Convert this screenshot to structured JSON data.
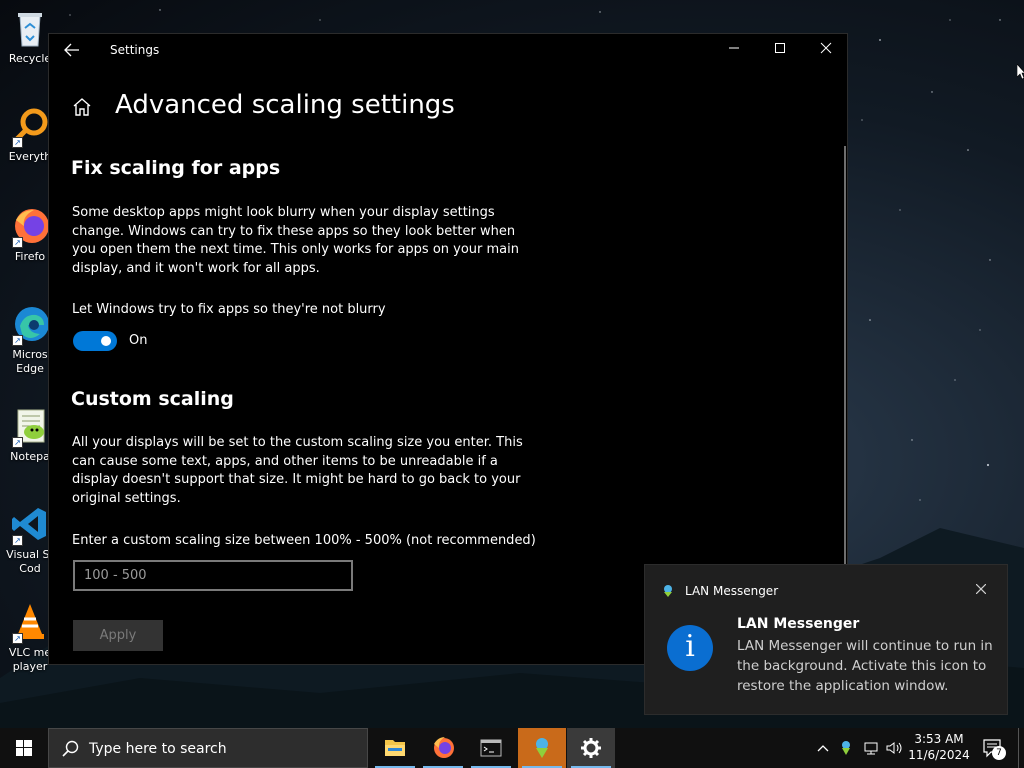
{
  "desktop": {
    "icons": [
      {
        "label": "Recycle"
      },
      {
        "label": "Everyth"
      },
      {
        "label": "Firefo"
      },
      {
        "label": "Micros\nEdge"
      },
      {
        "label": "Notepa"
      },
      {
        "label": "Visual St\nCod"
      },
      {
        "label": "VLC me\nplayer"
      }
    ]
  },
  "window": {
    "title": "Settings",
    "minimize_icon": "minimize-icon",
    "maximize_icon": "maximize-icon",
    "close_icon": "close-icon"
  },
  "settings": {
    "page_title": "Advanced scaling settings",
    "fix_section": {
      "title": "Fix scaling for apps",
      "description": "Some desktop apps might look blurry when your display settings change. Windows can try to fix these apps so they look better when you open them the next time. This only works for apps on your main display, and it won't work for all apps.",
      "toggle_label": "Let Windows try to fix apps so they're not blurry",
      "toggle_state": "On",
      "toggle_on": true
    },
    "custom_section": {
      "title": "Custom scaling",
      "description": "All your displays will be set to the custom scaling size you enter. This can cause some text, apps, and other items to be unreadable if a display doesn't support that size. It might be hard to go back to your original settings.",
      "input_label": "Enter a custom scaling size between 100% - 500% (not recommended)",
      "input_placeholder": "100 - 500",
      "input_value": "",
      "apply_label": "Apply"
    }
  },
  "notification": {
    "app_name": "LAN Messenger",
    "heading": "LAN Messenger",
    "message": "LAN Messenger will continue to run in the background. Activate this icon to restore the application window.",
    "icon": "info-icon"
  },
  "taskbar": {
    "search_placeholder": "Type here to search",
    "apps": [
      "file-explorer-icon",
      "firefox-icon",
      "terminal-icon",
      "lan-messenger-icon",
      "settings-icon"
    ],
    "tray": {
      "chevron": "^",
      "time": "3:53 AM",
      "date": "11/6/2024",
      "notification_count": "7"
    }
  },
  "colors": {
    "accent": "#0078d7",
    "window_bg": "#000000",
    "toast_bg": "#1f1f1f",
    "taskbar_bg": "#101010",
    "active_app": "#c96a1a"
  }
}
